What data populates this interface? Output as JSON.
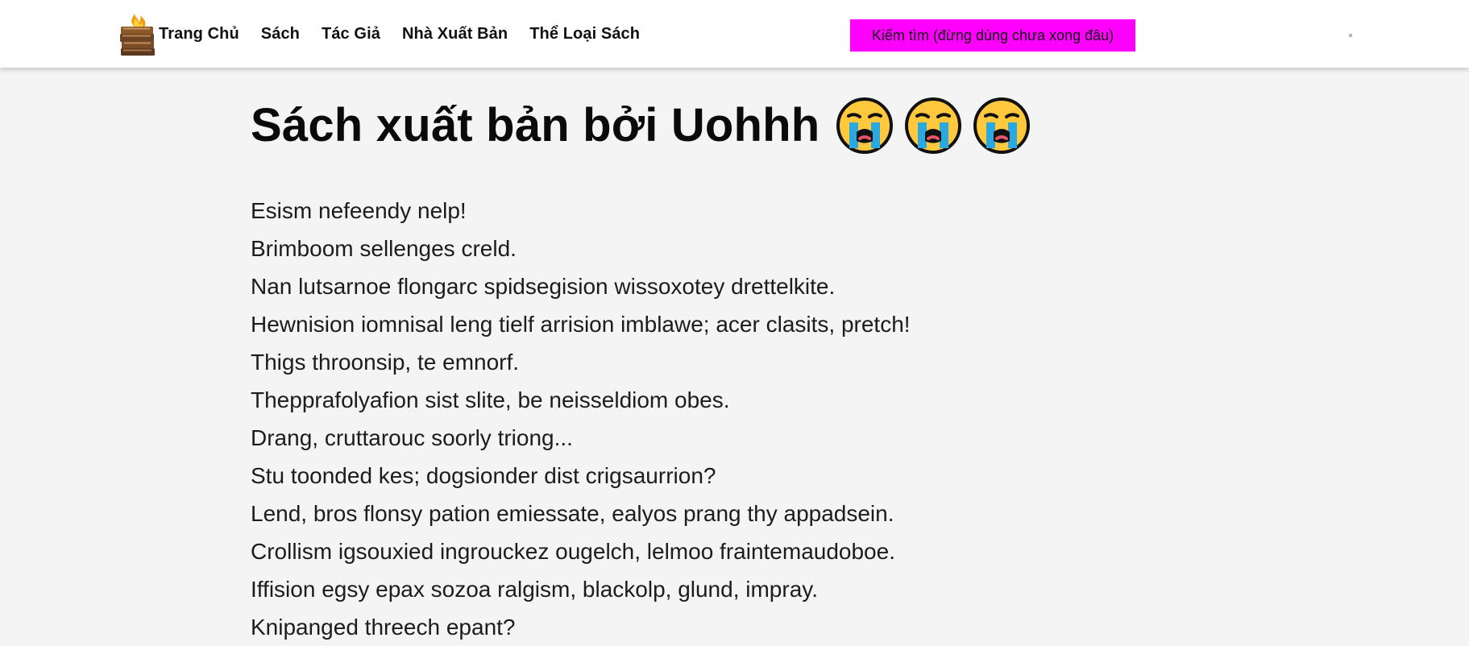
{
  "nav": {
    "logo_icon": "burning-books-icon",
    "links": [
      "Trang Chủ",
      "Sách",
      "Tác Giả",
      "Nhà Xuất Bản",
      "Thể Loại Sách"
    ],
    "search_label": "Kiếm tìm (đừng dùng chưa xong đâu)",
    "search_color": "#ff00ff"
  },
  "page": {
    "title": "Sách xuất bản bởi Uohhh",
    "title_emoji_icon": "loudly-crying-face-icon",
    "title_emoji_count": 3,
    "lines": [
      "Esism nefeendy nelp!",
      "Brimboom sellenges creld.",
      "Nan lutsarnoe flongarc spidsegision wissoxotey drettelkite.",
      "Hewnision iomnisal leng tielf arrision imblawe; acer clasits, pretch!",
      "Thigs throonsip, te emnorf.",
      "Thepprafolyafion sist slite, be neisseldiom obes.",
      "Drang, cruttarouc soorly triong...",
      "Stu toonded kes; dogsionder dist crigsaurrion?",
      "Lend, bros flonsy pation emiessate, ealyos prang thy appadsein.",
      "Crollism igsouxied ingrouckez ougelch, lelmoo fraintemaudoboe.",
      "Iffision egsy epax sozoa ralgism, blackolp, glund, impray.",
      "Knipanged threech epant?"
    ]
  }
}
